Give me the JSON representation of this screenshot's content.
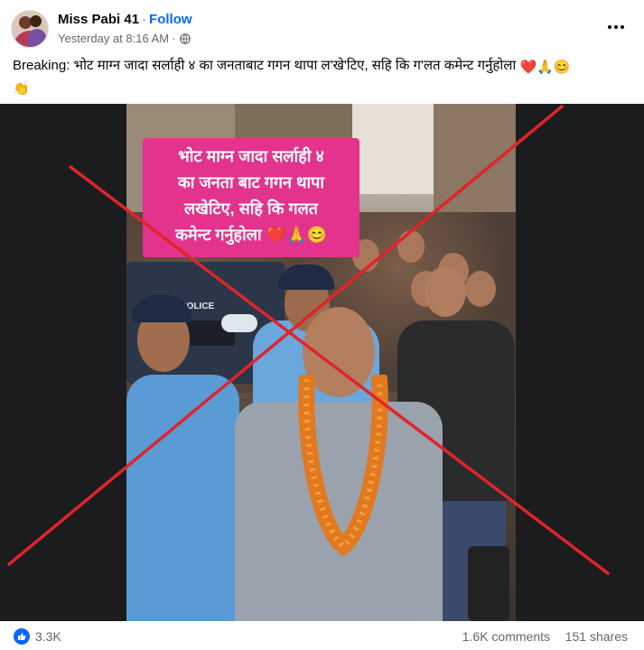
{
  "post": {
    "author": "Miss Pabi 41",
    "follow_label": "Follow",
    "timestamp": "Yesterday at 8:16 AM",
    "privacy_icon": "globe-icon",
    "more_icon": "more-horizontal-icon",
    "caption": "Breaking: भोट माग्न जादा सर्लाही ४ का जनताबाट गगन थापा ल'खे'टिए, सहि कि ग'लत कमेन्ट गर्नुहोला",
    "caption_emojis": "❤️🙏😊",
    "caption_emoji_2": "👏"
  },
  "image": {
    "banner_text_line1": "भोट माग्न जादा सर्लाही ४",
    "banner_text_line2": "का जनता बाट गगन थापा",
    "banner_text_line3": "लखेटिए, सहि कि गलत",
    "banner_text_line4": "कमेन्ट गर्नुहोला",
    "banner_emojis": "❤️🙏😊",
    "vehicle_label": "POLICE",
    "cross_mark_color": "#e0242b",
    "banner_color": "#e3338d"
  },
  "footer": {
    "reactions_icon": "like-icon",
    "reaction_count": "3.3K",
    "comments": "1.6K comments",
    "shares": "151 shares"
  },
  "colors": {
    "accent": "#0866ff",
    "muted_text": "#65676b"
  }
}
